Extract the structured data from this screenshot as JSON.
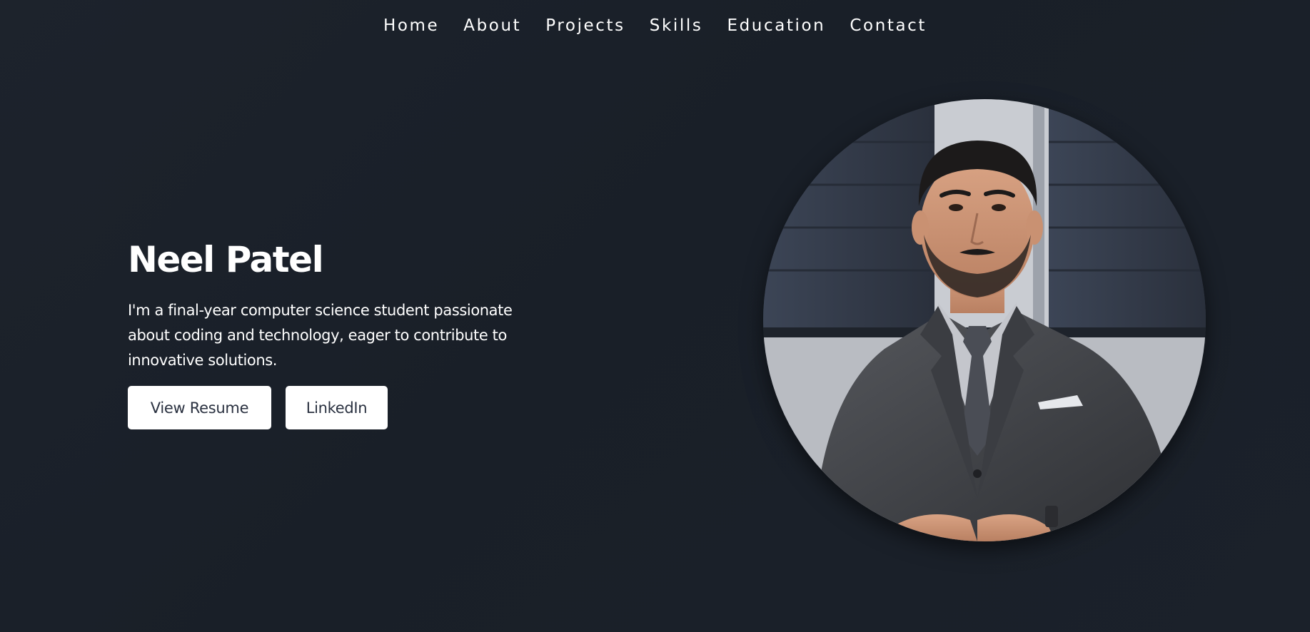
{
  "nav": {
    "items": [
      {
        "label": "Home"
      },
      {
        "label": "About"
      },
      {
        "label": "Projects"
      },
      {
        "label": "Skills"
      },
      {
        "label": "Education"
      },
      {
        "label": "Contact"
      }
    ]
  },
  "hero": {
    "name": "Neel Patel",
    "description": "I'm a final-year computer science student passionate about coding and technology, eager to contribute to innovative solutions.",
    "buttons": {
      "resume_label": "View Resume",
      "linkedin_label": "LinkedIn"
    }
  },
  "portrait": {
    "icon": "profile-photo"
  },
  "colors": {
    "background": "#1b212a",
    "text": "#ffffff",
    "button_bg": "#ffffff",
    "button_text": "#2a3140"
  }
}
